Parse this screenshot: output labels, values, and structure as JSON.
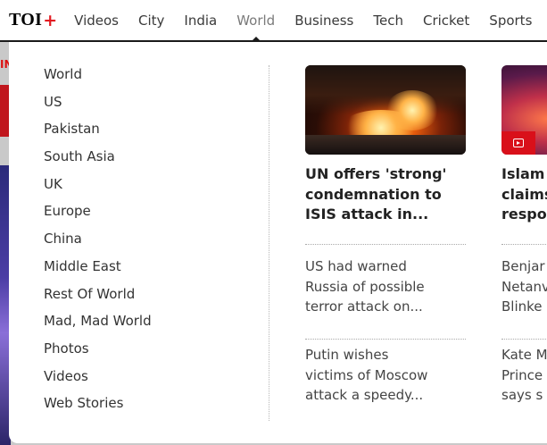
{
  "header": {
    "logo_text": "TOI",
    "logo_plus": "+",
    "nav": [
      "Videos",
      "City",
      "India",
      "World",
      "Business",
      "Tech",
      "Cricket",
      "Sports"
    ],
    "active_nav": "World"
  },
  "background": {
    "red_text": "IN"
  },
  "dropdown": {
    "menu": [
      "World",
      "US",
      "Pakistan",
      "South Asia",
      "UK",
      "Europe",
      "China",
      "Middle East",
      "Rest Of World",
      "Mad, Mad World",
      "Photos",
      "Videos",
      "Web Stories"
    ],
    "columns": [
      {
        "headline_lines": [
          "UN offers 'strong'",
          "condemnation to",
          "ISIS attack in..."
        ],
        "story1_lines": [
          "US had warned",
          "Russia of possible",
          "terror attack on..."
        ],
        "story2_lines": [
          "Putin wishes",
          "victims of Moscow",
          "attack a speedy..."
        ],
        "has_video": false
      },
      {
        "headline_lines": [
          "Islam",
          "claims",
          "respo"
        ],
        "story1_lines": [
          "Benjar",
          "Netanv",
          "Blinke"
        ],
        "story2_lines": [
          "Kate M",
          "Prince",
          "says s"
        ],
        "has_video": true
      }
    ]
  },
  "colors": {
    "brand_red": "#e21b22",
    "video_badge": "#d9101a",
    "nav_text": "#3a3a3a",
    "active_nav_text": "#7a7a7a"
  }
}
